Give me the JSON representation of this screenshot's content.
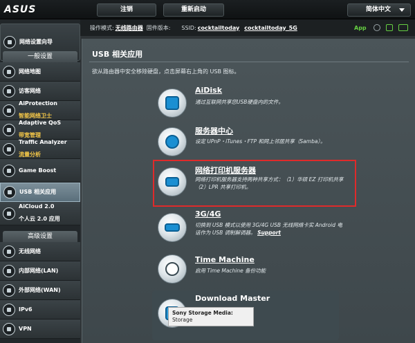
{
  "header": {
    "logo": "ASUS",
    "logout_label": "注销",
    "reboot_label": "重新启动",
    "language_label": "简体中文"
  },
  "status": {
    "mode_label": "操作模式:",
    "mode_value": "无线路由器",
    "firmware_label": "固件版本:",
    "ssid_label": "SSID:",
    "ssid_1": "cocktailtoday",
    "ssid_2": "cocktailtoday_5G",
    "app_label": "App"
  },
  "sidebar": {
    "qis_label": "网络设置向导",
    "general_header": "一般设置",
    "items": [
      {
        "label": "网络地图",
        "sub": ""
      },
      {
        "label": "访客网络",
        "sub": ""
      },
      {
        "label": "AiProtection",
        "sub": "智能网络卫士"
      },
      {
        "label": "Adaptive QoS",
        "sub": "带宽管理"
      },
      {
        "label": "Traffic Analyzer",
        "sub": "流量分析"
      },
      {
        "label": "Game Boost",
        "sub": ""
      },
      {
        "label": "USB 相关应用",
        "sub": ""
      },
      {
        "label": "AiCloud 2.0",
        "sub": "个人云 2.0 应用"
      }
    ],
    "advanced_header": "高级设置",
    "adv_items": [
      {
        "label": "无线网络"
      },
      {
        "label": "内部网络(LAN)"
      },
      {
        "label": "外部网络(WAN)"
      },
      {
        "label": "IPv6"
      },
      {
        "label": "VPN"
      }
    ]
  },
  "main": {
    "title": "USB 相关应用",
    "description": "欲从路由器中安全移除硬盘，点击屏幕右上角的 USB 图标。",
    "features": [
      {
        "title": "AiDisk",
        "desc": "通过互联网共享您USB硬盘内的文件。",
        "icon": "aidisk-icon"
      },
      {
        "title": "服务器中心",
        "desc": "设定 UPnP・iTunes・FTP 和网上邻居共享（Samba）。",
        "icon": "server-center-icon"
      },
      {
        "title": "网络打印机服务器",
        "desc": "网络打印机服务器支持两种共享方式：（1）华硕 EZ 打印机共享（2）LPR 共享打印机。",
        "icon": "printer-icon"
      },
      {
        "title": "3G/4G",
        "desc": "切换到 USB 模式以使用 3G/4G USB 无线网络卡实 Android 电话作为 USB 调制解调器。",
        "link": "Support",
        "icon": "modem-icon"
      },
      {
        "title": "Time Machine",
        "desc": "启用 Time Machine 备份功能",
        "icon": "time-machine-icon"
      },
      {
        "title": "Download Master",
        "desc": "",
        "icon": "download-master-icon"
      }
    ]
  },
  "tooltip": {
    "title": "Sony Storage Media:",
    "subtitle": "Storage"
  },
  "colors": {
    "accent_green": "#66d042",
    "highlight_red": "#e02a2a",
    "sub_yellow": "#f7c948"
  }
}
